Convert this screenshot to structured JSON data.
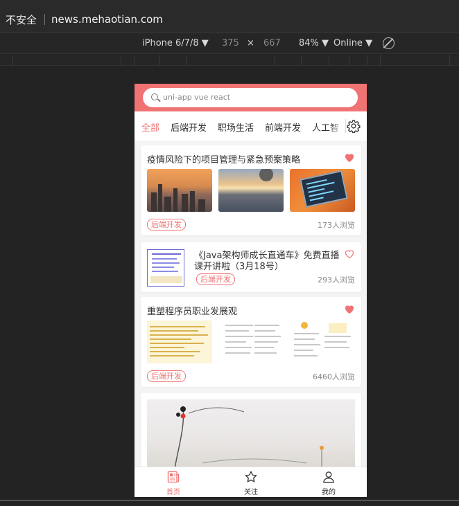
{
  "browser": {
    "insecure_label": "不安全",
    "url": "news.mehaotian.com"
  },
  "devtools": {
    "device": "iPhone 6/7/8 ▼",
    "width": "375",
    "times": "×",
    "height": "667",
    "zoom": "84% ▼",
    "network": "Online ▼"
  },
  "search": {
    "placeholder": "uni-app vue react"
  },
  "tabs": [
    "全部",
    "后端开发",
    "职场生活",
    "前端开发",
    "人工智"
  ],
  "cards": [
    {
      "title": "疫情风险下的项目管理与紧急预案策略",
      "tag": "后端开发",
      "views": "173人浏览",
      "liked": true
    },
    {
      "title_line1": "《Java架构师成长直通车》免费直播",
      "title_line2": "课开讲啦（3月18号）",
      "tag": "后端开发",
      "views": "293人浏览",
      "liked": false
    },
    {
      "title": "重塑程序员职业发展观",
      "tag": "后端开发",
      "views": "6460人浏览",
      "liked": true
    }
  ],
  "tabbar": [
    {
      "label": "首页",
      "icon": "home-news-icon",
      "active": true
    },
    {
      "label": "关注",
      "icon": "star-icon",
      "active": false
    },
    {
      "label": "我的",
      "icon": "user-icon",
      "active": false
    }
  ],
  "colors": {
    "accent": "#f07373",
    "background": "#f4f4f4"
  }
}
